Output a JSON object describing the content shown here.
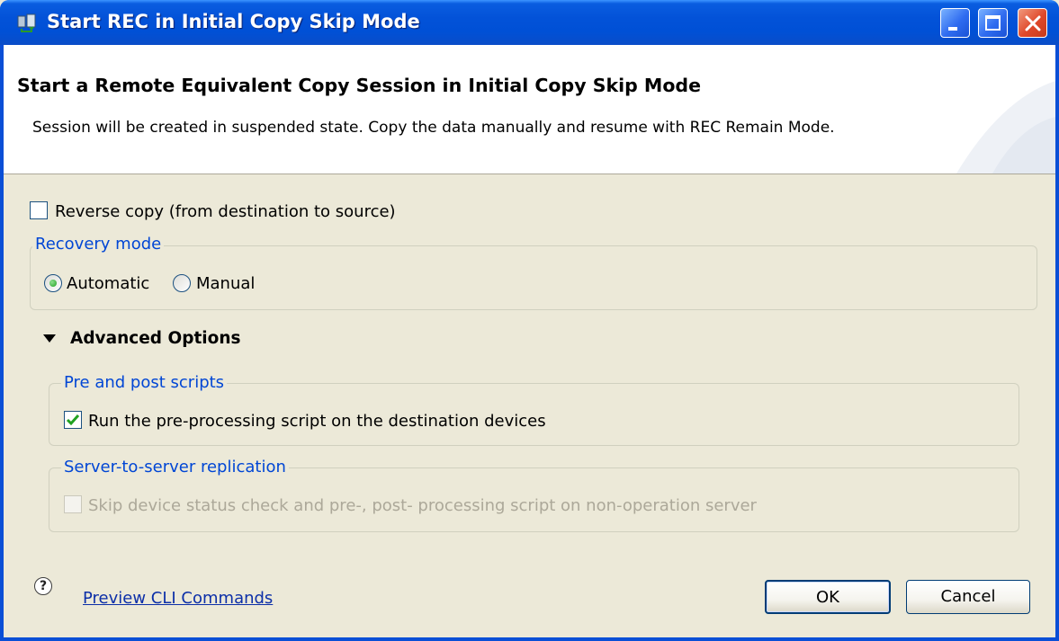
{
  "window": {
    "title": "Start REC in Initial Copy Skip Mode",
    "app_icon": "app-icon",
    "controls": [
      "minimize-icon",
      "maximize-icon",
      "close-icon"
    ]
  },
  "header": {
    "title": "Start a Remote Equivalent Copy Session in Initial Copy Skip Mode",
    "description": "Session will be created in suspended state. Copy the data manually and resume with REC Remain Mode."
  },
  "options": {
    "reverse_copy": {
      "label": "Reverse copy (from destination to source)",
      "checked": false
    }
  },
  "recovery_mode": {
    "legend": "Recovery mode",
    "options": [
      {
        "label": "Automatic",
        "selected": true
      },
      {
        "label": "Manual",
        "selected": false
      }
    ]
  },
  "advanced": {
    "title": "Advanced Options",
    "expanded": true,
    "scripts": {
      "legend": "Pre and post scripts",
      "run_pre": {
        "label": "Run the pre-processing script on the destination devices",
        "checked": true
      }
    },
    "replication": {
      "legend": "Server-to-server replication",
      "skip": {
        "label": "Skip device status check and pre-, post- processing script on non-operation server",
        "checked": false,
        "enabled": false
      }
    }
  },
  "footer": {
    "help_icon": "help-icon",
    "link": "Preview CLI Commands",
    "ok": "OK",
    "cancel": "Cancel"
  },
  "colors": {
    "titlebar": "#0a5de0",
    "dialog_bg": "#ece9d8",
    "group_legend": "#0046d5",
    "link": "#0c2fa8",
    "check": "#21a121"
  }
}
